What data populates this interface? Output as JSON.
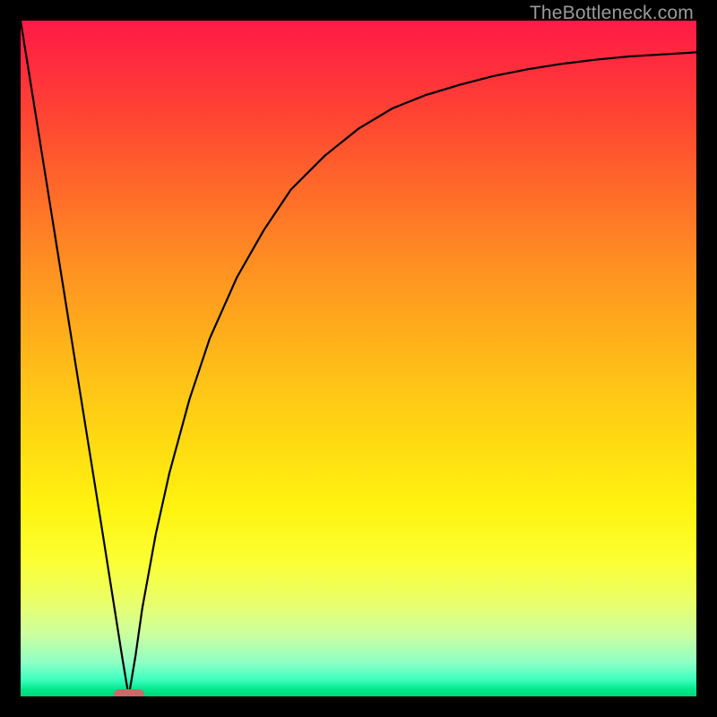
{
  "watermark": "TheBottleneck.com",
  "colors": {
    "frame": "#000000",
    "pill": "#c76a6a",
    "curve": "#000000"
  },
  "chart_data": {
    "type": "line",
    "title": "",
    "xlabel": "",
    "ylabel": "",
    "xlim": [
      0,
      100
    ],
    "ylim": [
      0,
      100
    ],
    "grid": false,
    "legend": false,
    "notes": "background vertical gradient red→orange→yellow→green represents bottleneck severity (top=high, bottom=low); black curve shows bottleneck vs component balance with minimum near x≈16",
    "series": [
      {
        "name": "bottleneck-curve",
        "x": [
          0,
          4,
          8,
          12,
          15,
          16,
          17,
          18,
          20,
          22,
          25,
          28,
          32,
          36,
          40,
          45,
          50,
          55,
          60,
          65,
          70,
          75,
          80,
          85,
          90,
          95,
          100
        ],
        "values": [
          100,
          75,
          50,
          25,
          6,
          0,
          6,
          13,
          24,
          33,
          44,
          53,
          62,
          69,
          75,
          80,
          84,
          87,
          89,
          90.5,
          91.8,
          92.8,
          93.6,
          94.2,
          94.7,
          95.0,
          95.3
        ]
      }
    ],
    "marker": {
      "name": "optimal-point",
      "x": 16,
      "y": 0
    }
  }
}
